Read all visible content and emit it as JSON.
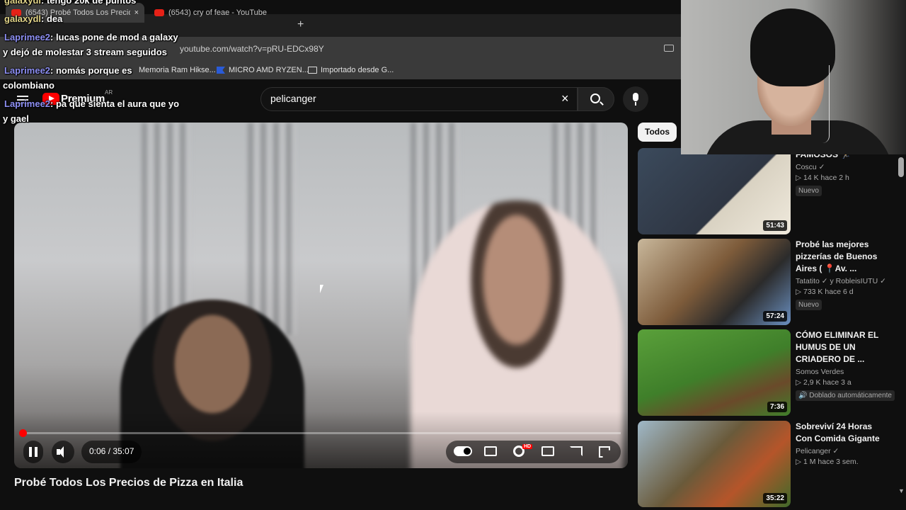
{
  "browser": {
    "tabs": [
      {
        "title": "(6543) Probé Todos Los Precio",
        "active": true,
        "close": "×"
      },
      {
        "title": "(6543) cry of feae - YouTube",
        "active": false
      }
    ],
    "new_tab": "+",
    "url": "youtube.com/watch?v=pRU-EDCx98Y",
    "bookmarks": [
      "Memoria Ram Hikse...",
      "MICRO AMD RYZEN...",
      "Importado desde G..."
    ]
  },
  "youtube": {
    "logo_text": "Premium",
    "region": "AR",
    "search": {
      "value": "pelicanger",
      "clear": "×"
    },
    "player": {
      "time": "0:06 / 35:07",
      "progress": 0.003,
      "quality_badge": "HD"
    },
    "video_title": "Probé Todos Los Precios de Pizza en Italia",
    "chip": "Todos",
    "related": [
      {
        "title": "FAMOSOS 🏃",
        "channel": "Coscu ✓",
        "stats": "▷ 14 K  hace 2 h",
        "badge": "Nuevo",
        "duration": "51:43",
        "thumb_color": "#3b4a5c"
      },
      {
        "title": "Probé las mejores pizzerías de Buenos Aires ( 📍Av. ...",
        "channel": "Tatatito ✓ y RobleisIUTU ✓",
        "stats": "▷ 733 K  hace 6 d",
        "badge": "Nuevo",
        "duration": "57:24",
        "thumb_color": "#7d5b3a"
      },
      {
        "title": "CÓMO ELIMINAR EL HUMUS DE UN CRIADERO DE ...",
        "channel": "Somos Verdes",
        "stats": "▷ 2,9 K  hace 3 a",
        "badge": "🔊 Doblado automáticamente",
        "duration": "7:36",
        "thumb_color": "#3f7f2a"
      },
      {
        "title": "Sobreviví 24 Horas Con Comida Gigante",
        "channel": "Pelicanger ✓",
        "stats": "▷ 1 M  hace 3 sem.",
        "badge": "",
        "duration": "35:22",
        "thumb_color": "#6a5a3a"
      }
    ]
  },
  "chat": [
    {
      "user": "galaxydl",
      "text": ": tengo 20k de puntos"
    },
    {
      "user": "galaxydl",
      "text": ": dea"
    },
    {
      "user": "Laprimee2",
      "text": ": lucas pone de mod a galaxy"
    },
    {
      "user": "",
      "text": "y dejó de molestar 3 stream seguidos"
    },
    {
      "user": "Laprimee2",
      "text": ": nomás porque es"
    },
    {
      "user": "",
      "text": "colombiano"
    },
    {
      "user": "Laprimee2",
      "text": ": pa que sienta el aura que yo"
    },
    {
      "user": "",
      "text": "y gael"
    }
  ]
}
